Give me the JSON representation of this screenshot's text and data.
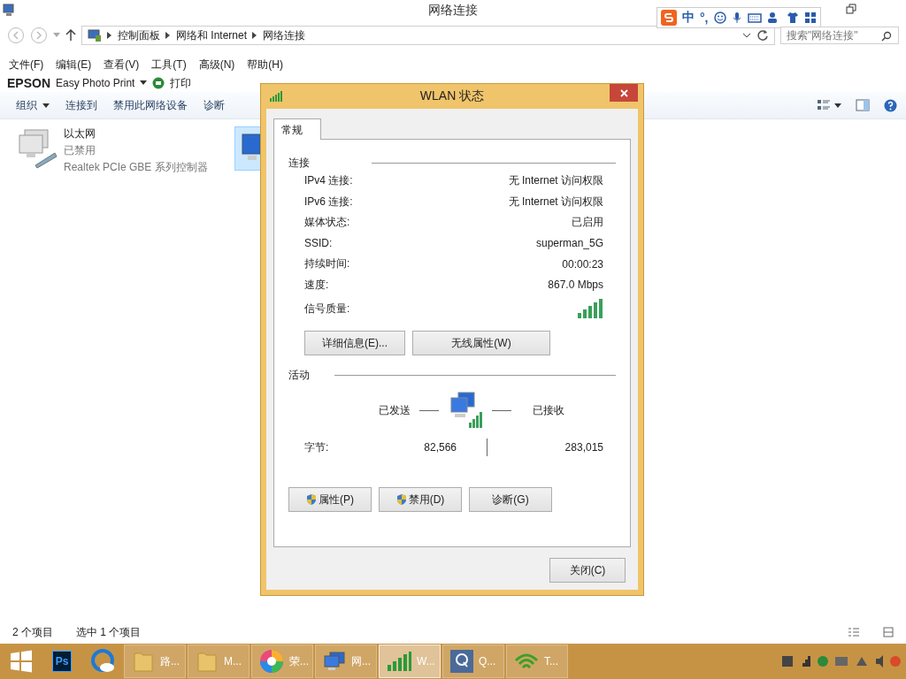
{
  "window": {
    "title": "网络连接"
  },
  "ime": {
    "lang": "中",
    "punct": "°,"
  },
  "address": {
    "breadcrumb": [
      "控制面板",
      "网络和 Internet",
      "网络连接"
    ],
    "search_placeholder": "搜索\"网络连接\""
  },
  "menu": [
    "文件(F)",
    "编辑(E)",
    "查看(V)",
    "工具(T)",
    "高级(N)",
    "帮助(H)"
  ],
  "epson": {
    "brand": "EPSON",
    "app": "Easy Photo Print",
    "print": "打印"
  },
  "commands": [
    {
      "label": "组织",
      "dropdown": true
    },
    {
      "label": "连接到",
      "dropdown": false
    },
    {
      "label": "禁用此网络设备",
      "dropdown": false
    },
    {
      "label": "诊断",
      "dropdown": false
    }
  ],
  "items": [
    {
      "name": "以太网",
      "status": "已禁用",
      "device": "Realtek PCIe GBE 系列控制器",
      "selected": false,
      "kind": "ethernet"
    },
    {
      "selected": true,
      "kind": "wireless"
    }
  ],
  "status_bar": {
    "count": "2 个项目",
    "selection": "选中 1 个项目"
  },
  "dialog": {
    "title": "WLAN 状态",
    "tabs": [
      {
        "label": "常规",
        "selected": true
      }
    ],
    "connection": {
      "heading": "连接",
      "rows": [
        {
          "label": "IPv4 连接:",
          "value": "无 Internet 访问权限"
        },
        {
          "label": "IPv6 连接:",
          "value": "无 Internet 访问权限"
        },
        {
          "label": "媒体状态:",
          "value": "已启用"
        },
        {
          "label": "SSID:",
          "value": "superman_5G"
        },
        {
          "label": "持续时间:",
          "value": "00:00:23"
        },
        {
          "label": "速度:",
          "value": "867.0 Mbps"
        }
      ],
      "signal_label": "信号质量:",
      "buttons": [
        "详细信息(E)...",
        "无线属性(W)"
      ]
    },
    "activity": {
      "heading": "活动",
      "sent": "已发送",
      "received": "已接收",
      "bytes_label": "字节:",
      "bytes_sent": "82,566",
      "bytes_received": "283,015"
    },
    "buttons": [
      {
        "label": "属性(P)",
        "shield": true
      },
      {
        "label": "禁用(D)",
        "shield": true
      },
      {
        "label": "诊断(G)",
        "shield": false
      }
    ],
    "close": "关闭(C)"
  },
  "taskbar": [
    {
      "kind": "start",
      "active": false
    },
    {
      "kind": "ps",
      "label": "Ps",
      "active": false
    },
    {
      "kind": "browser",
      "active": false
    },
    {
      "kind": "folder",
      "label": "路...",
      "active": false
    },
    {
      "kind": "folder",
      "label": "M...",
      "active": false
    },
    {
      "kind": "pinwheel",
      "label": "荣...",
      "active": false
    },
    {
      "kind": "network",
      "label": "网...",
      "active": false
    },
    {
      "kind": "signal",
      "label": "W...",
      "active": true
    },
    {
      "kind": "q",
      "label": "Q...",
      "active": false
    },
    {
      "kind": "wifi",
      "label": "T...",
      "active": false
    }
  ]
}
